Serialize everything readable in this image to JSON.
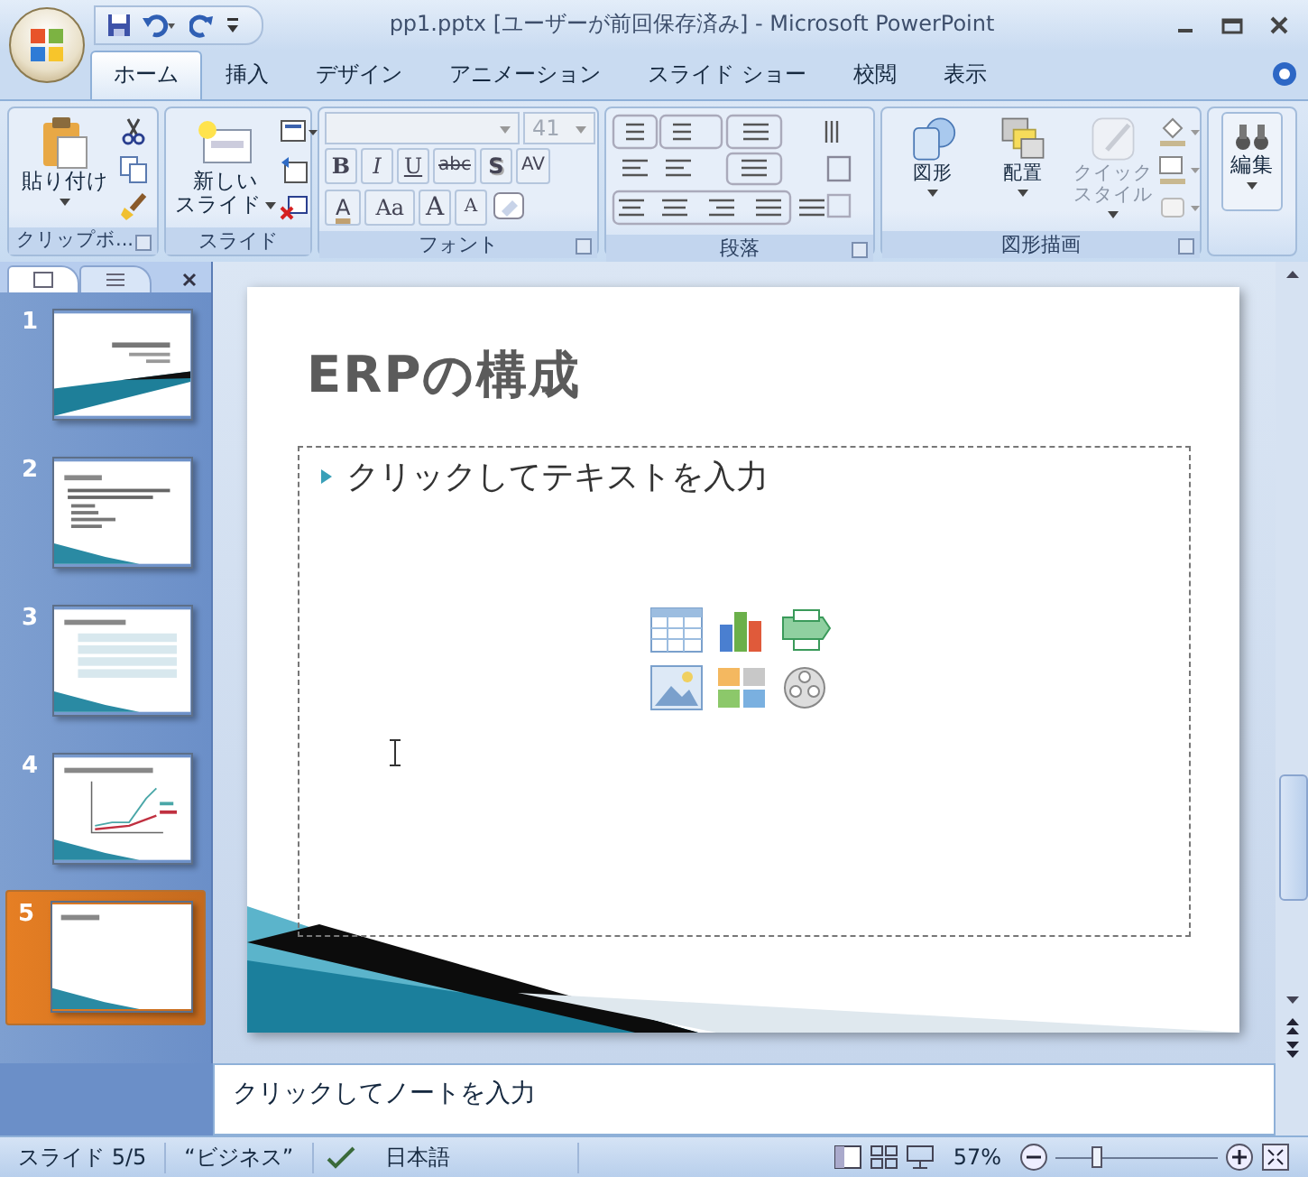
{
  "window": {
    "title": "pp1.pptx [ユーザーが前回保存済み] - Microsoft PowerPoint"
  },
  "tabs": [
    {
      "label": "ホーム",
      "selected": true
    },
    {
      "label": "挿入",
      "selected": false
    },
    {
      "label": "デザイン",
      "selected": false
    },
    {
      "label": "アニメーション",
      "selected": false
    },
    {
      "label": "スライド ショー",
      "selected": false
    },
    {
      "label": "校閲",
      "selected": false
    },
    {
      "label": "表示",
      "selected": false
    }
  ],
  "ribbon": {
    "clipboard": {
      "label": "クリップボ...",
      "paste": "貼り付け"
    },
    "slides": {
      "label": "スライド",
      "new_slide": [
        "新しい",
        "スライド"
      ]
    },
    "font": {
      "label": "フォント",
      "size": {
        "value": "41",
        "disabled": true
      },
      "bold": "B",
      "italic": "I",
      "underline": "U",
      "strike": "abc",
      "shadow": "S",
      "spacing": "AV",
      "color_button": "A",
      "case": "Aa",
      "grow": "A",
      "shrink": "A"
    },
    "paragraph": {
      "label": "段落"
    },
    "drawing": {
      "label": "図形描画",
      "buttons": [
        {
          "lines": [
            "図形"
          ],
          "disabled": false
        },
        {
          "lines": [
            "配置"
          ],
          "disabled": false
        },
        {
          "lines": [
            "クイック",
            "スタイル"
          ],
          "disabled": true
        }
      ]
    },
    "editing": {
      "label": "編集"
    }
  },
  "slide_panel": {
    "thumbnails": [
      {
        "number": "1",
        "selected": false
      },
      {
        "number": "2",
        "selected": false
      },
      {
        "number": "3",
        "selected": false
      },
      {
        "number": "4",
        "selected": false
      },
      {
        "number": "5",
        "selected": true
      }
    ]
  },
  "slide": {
    "title": "ERPの構成",
    "placeholder": "クリックしてテキストを入力"
  },
  "notes": {
    "placeholder": "クリックしてノートを入力"
  },
  "status_bar": {
    "slide": "スライド 5/5",
    "theme": "“ビジネス”",
    "language": "日本語",
    "zoom": "57%",
    "level": 0.26
  }
}
